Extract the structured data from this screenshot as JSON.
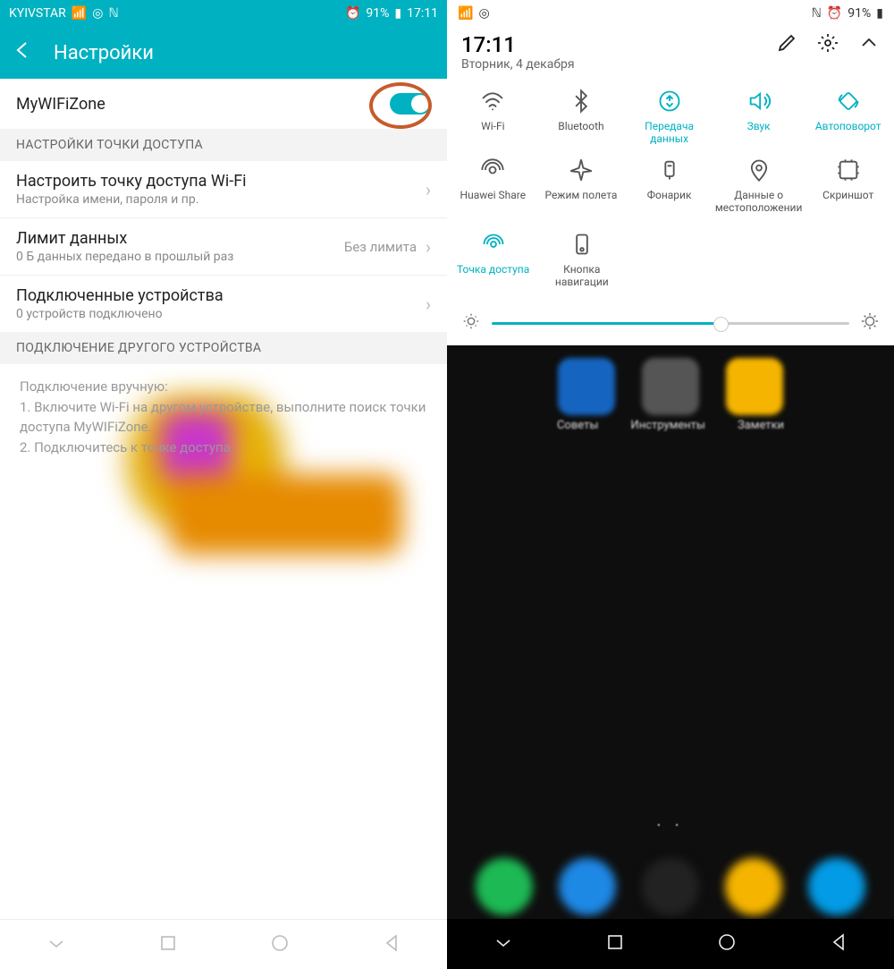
{
  "left": {
    "carrier": "KYIVSTAR",
    "battery": "91%",
    "time": "17:11",
    "title": "Настройки",
    "hotspot_name": "MyWIFiZone",
    "section1": "НАСТРОЙКИ ТОЧКИ ДОСТУПА",
    "row_configure": "Настроить точку доступа Wi-Fi",
    "row_configure_sub": "Настройка имени, пароля и пр.",
    "row_limit": "Лимит данных",
    "row_limit_sub": "0 Б данных передано в прошлый раз",
    "row_limit_value": "Без лимита",
    "row_devices": "Подключенные устройства",
    "row_devices_sub": "0 устройств подключено",
    "section2": "ПОДКЛЮЧЕНИЕ ДРУГОГО УСТРОЙСТВА",
    "manual_head": "Подключение вручную:",
    "manual_1": "1. Включите Wi-Fi на другом устройстве, выполните поиск точки доступа MyWIFiZone.",
    "manual_2": "2. Подключитесь к точке доступа."
  },
  "right": {
    "battery": "91%",
    "time": "17:11",
    "date": "Вторник, 4 декабря",
    "tiles": [
      {
        "label": "Wi-Fi",
        "active": false,
        "icon": "wifi"
      },
      {
        "label": "Bluetooth",
        "active": false,
        "icon": "bluetooth"
      },
      {
        "label": "Передача данных",
        "active": true,
        "icon": "data"
      },
      {
        "label": "Звук",
        "active": true,
        "icon": "sound"
      },
      {
        "label": "Автоповорот",
        "active": true,
        "icon": "rotate"
      },
      {
        "label": "Huawei Share",
        "active": false,
        "icon": "share"
      },
      {
        "label": "Режим полета",
        "active": false,
        "icon": "airplane"
      },
      {
        "label": "Фонарик",
        "active": false,
        "icon": "flash"
      },
      {
        "label": "Данные о местоположении",
        "active": false,
        "icon": "location"
      },
      {
        "label": "Скриншот",
        "active": false,
        "icon": "screenshot"
      }
    ],
    "row3": [
      {
        "label": "Точка доступа",
        "active": true,
        "icon": "hotspot"
      },
      {
        "label": "Кнопка навигации",
        "active": false,
        "icon": "navbtn"
      }
    ],
    "apps": [
      "Советы",
      "Инструменты",
      "Заметки"
    ]
  }
}
